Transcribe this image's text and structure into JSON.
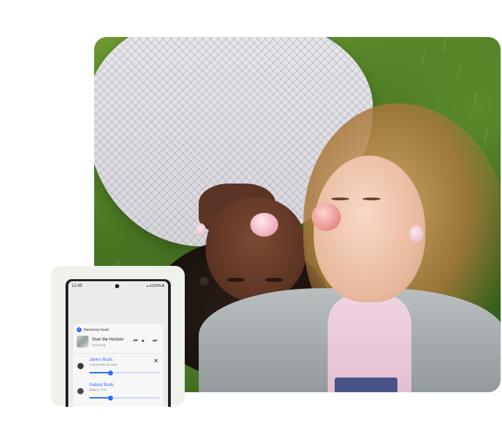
{
  "phone": {
    "status_time": "12:45",
    "status_right": "⩦.ıl100%▮",
    "media": {
      "app_name": "Samsung music",
      "track_title": "Over the Horizon",
      "track_artist": "Samsung",
      "prev_icon": "⏮",
      "play_pause_icon": "⏸",
      "next_icon": "⏭"
    },
    "devices": [
      {
        "name": "Jane's Buds",
        "status": "Connected via Jane",
        "volume_fraction": 0.3,
        "close_icon": "✕"
      },
      {
        "name": "Galaxy Buds",
        "status": "Battery 77%",
        "volume_fraction": 0.3
      }
    ]
  },
  "colors": {
    "accent": "#2d6bff",
    "card_background": "#eef2ea",
    "phone_frame": "#1f1f21"
  }
}
